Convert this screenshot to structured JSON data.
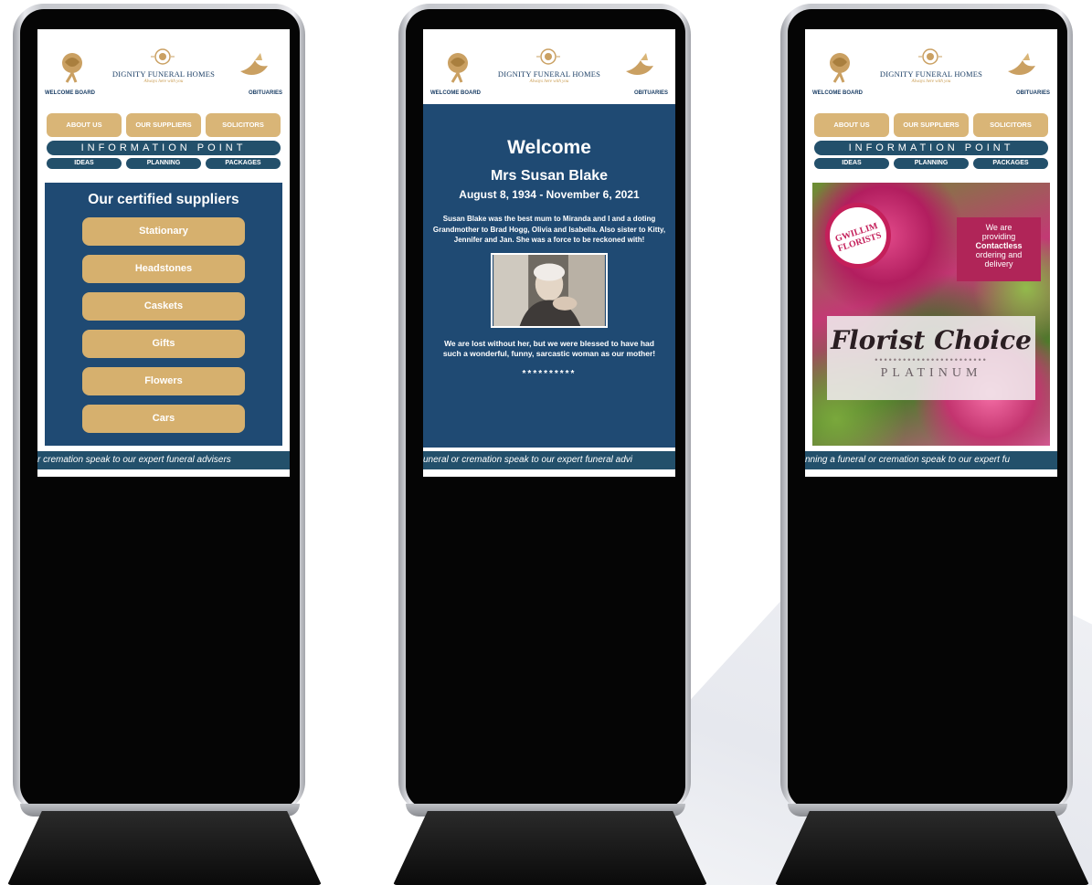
{
  "brand": {
    "name": "DIGNITY FUNERAL HOMES",
    "tagline": "Always here with you",
    "welcome_board_link": "WELCOME BOARD",
    "obituaries_link": "OBITUARIES"
  },
  "nav": {
    "buttons": [
      "ABOUT US",
      "OUR SUPPLIERS",
      "SOLICITORS"
    ],
    "info_point": "INFORMATION POINT",
    "sub_buttons": [
      "IDEAS",
      "PLANNING",
      "PACKAGES"
    ]
  },
  "screen1": {
    "title": "Our certified suppliers",
    "suppliers": [
      "Stationary",
      "Headstones",
      "Caskets",
      "Gifts",
      "Flowers",
      "Cars"
    ],
    "ticker": "r cremation speak to our expert funeral advisers"
  },
  "screen2": {
    "title": "Welcome",
    "name": "Mrs Susan Blake",
    "dates": "August 8, 1934 -  November 6, 2021",
    "bio": "Susan Blake was the best mum to Miranda and I and a doting Grandmother to Brad Hogg, Olivia and Isabella. Also sister to Kitty, Jennifer and Jan. She was a force to be reckoned with!",
    "closing": "We are lost without her, but we were blessed to have had such a wonderful, funny, sarcastic woman as our mother!",
    "stars": "**********",
    "ticker": "uneral or cremation speak to our expert funeral advi"
  },
  "screen3": {
    "badge_line1": "GWILLIM",
    "badge_line2": "FLORISTS",
    "promo_line1": "We are",
    "promo_line2": "providing",
    "promo_line3": "Contactless",
    "promo_line4": "ordering and",
    "promo_line5": "delivery",
    "banner_title": "Florist Choice",
    "banner_subtitle": "PLATINUM",
    "ticker": "nning a funeral or cremation speak to our expert fu"
  },
  "colors": {
    "navy": "#1f4a73",
    "gold": "#d6b06e",
    "teal_navy": "#23506b",
    "magenta": "#b02558"
  },
  "icons": {
    "left_logo": "rose-icon",
    "right_logo": "dove-icon",
    "center_logo": "rose-emblem-icon"
  }
}
